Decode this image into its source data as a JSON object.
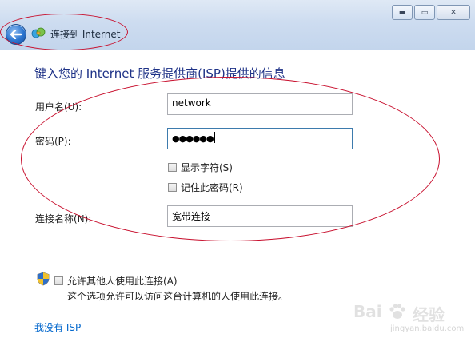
{
  "window": {
    "title": "连接到 Internet",
    "controls": {
      "minimize": "▬",
      "maximize": "▭",
      "close": "✕"
    }
  },
  "page": {
    "heading": "键入您的 Internet 服务提供商(ISP)提供的信息"
  },
  "form": {
    "username": {
      "label": "用户名(U):",
      "value": "network"
    },
    "password": {
      "label": "密码(P):",
      "value": "●●●●●●"
    },
    "show_chars": {
      "label": "显示字符(S)",
      "checked": false
    },
    "remember": {
      "label": "记住此密码(R)",
      "checked": false
    },
    "conn_name": {
      "label": "连接名称(N):",
      "value": "宽带连接"
    }
  },
  "sharing": {
    "allow_label": "允许其他人使用此连接(A)",
    "allow_checked": false,
    "description": "这个选项允许可以访问这台计算机的人使用此连接。"
  },
  "links": {
    "no_isp": "我没有 ISP"
  },
  "watermark": {
    "brand_a": "Bai",
    "brand_b": "经验",
    "site": "jingyan.baidu.com"
  },
  "colors": {
    "heading": "#1e3287",
    "link": "#0066cc",
    "annotation": "#c8102e"
  },
  "icons": {
    "back": "back-arrow-icon",
    "globe": "network-globe-icon",
    "shield": "uac-shield-icon"
  }
}
